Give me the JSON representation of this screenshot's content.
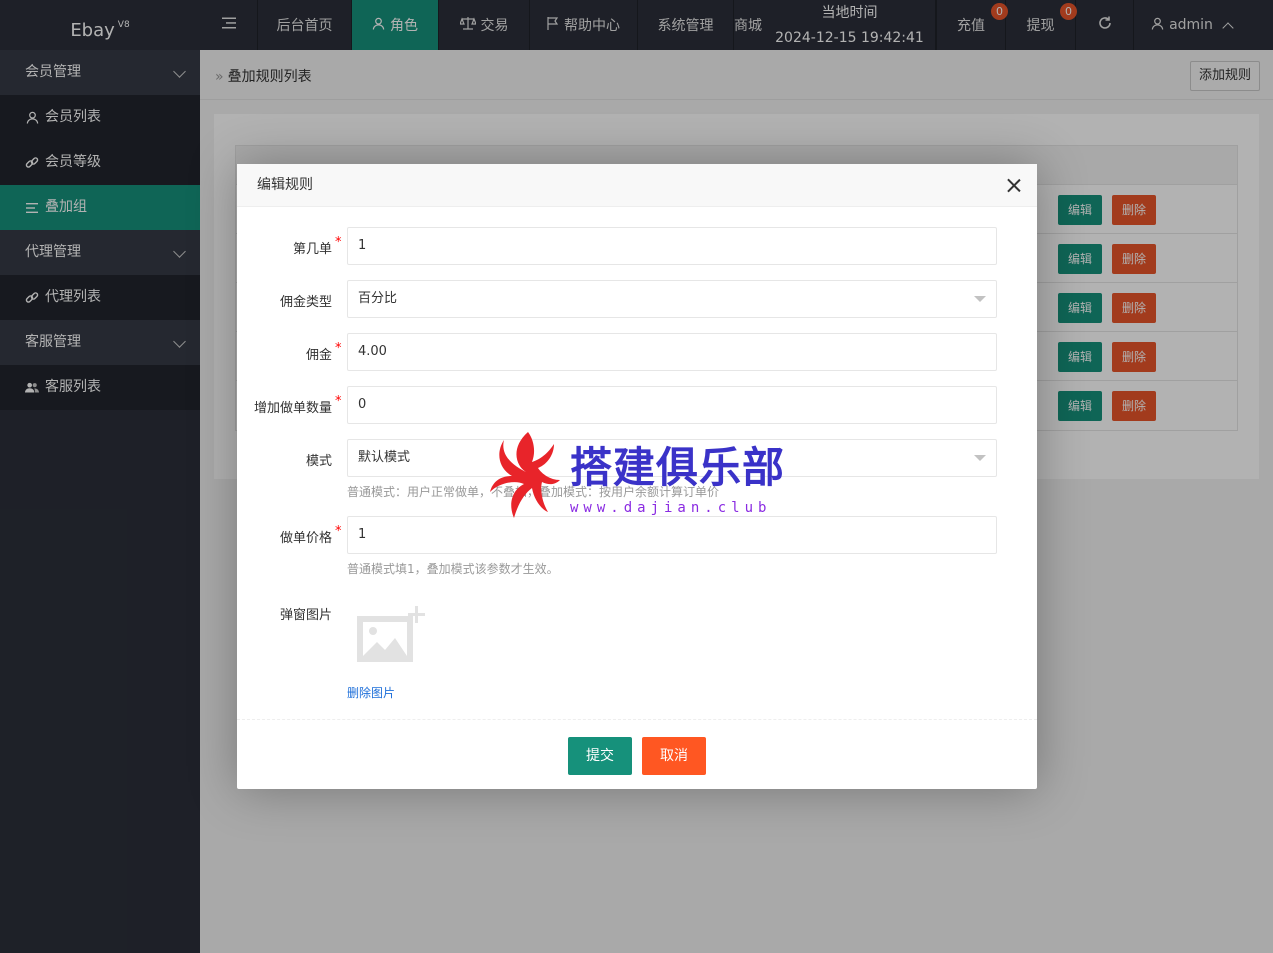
{
  "sidebar": {
    "logo": "Ebay",
    "logo_sup": "V8",
    "groups": [
      {
        "label": "会员管理",
        "items": [
          {
            "label": "会员列表",
            "icon": "user-icon"
          },
          {
            "label": "会员等级",
            "icon": "link-icon"
          },
          {
            "label": "叠加组",
            "icon": "list-icon",
            "active": true
          }
        ]
      },
      {
        "label": "代理管理",
        "items": [
          {
            "label": "代理列表",
            "icon": "link-icon"
          }
        ]
      },
      {
        "label": "客服管理",
        "items": [
          {
            "label": "客服列表",
            "icon": "users-icon"
          }
        ]
      }
    ]
  },
  "topbar": {
    "menu_icon": "menu-fold-icon",
    "items": [
      {
        "label": "后台首页"
      },
      {
        "label": "角色",
        "icon": "user-icon",
        "active": true
      },
      {
        "label": "交易",
        "icon": "scale-icon"
      },
      {
        "label": "帮助中心",
        "icon": "flag-icon"
      },
      {
        "label": "系统管理"
      },
      {
        "label": "商城"
      }
    ],
    "time_label": "当地时间",
    "time_value": "2024-12-15 19:42:41",
    "recharge": {
      "label": "充值",
      "badge": "0"
    },
    "withdraw": {
      "label": "提现",
      "badge": "0"
    },
    "refresh_icon": "refresh-icon",
    "user": {
      "name": "admin"
    }
  },
  "page": {
    "breadcrumb": "叠加规则列表",
    "add_button": "添加规则",
    "table": {
      "rows": [
        {
          "edit": "编辑",
          "delete": "删除"
        },
        {
          "edit": "编辑",
          "delete": "删除"
        },
        {
          "edit": "编辑",
          "delete": "删除"
        },
        {
          "edit": "编辑",
          "delete": "删除"
        },
        {
          "edit": "编辑",
          "delete": "删除"
        }
      ]
    }
  },
  "modal": {
    "title": "编辑规则",
    "fields": {
      "order_no": {
        "label": "第几单",
        "value": "1",
        "required": true
      },
      "commission_type": {
        "label": "佣金类型",
        "value": "百分比"
      },
      "commission": {
        "label": "佣金",
        "value": "4.00",
        "required": true
      },
      "extra_orders": {
        "label": "增加做单数量",
        "value": "0",
        "required": true
      },
      "mode": {
        "label": "模式",
        "value": "默认模式",
        "hint": "普通模式：用户正常做单，不叠加，叠加模式：按用户余额计算订单价"
      },
      "price": {
        "label": "做单价格",
        "value": "1",
        "required": true,
        "hint": "普通模式填1，叠加模式该参数才生效。"
      },
      "popup_image": {
        "label": "弹窗图片",
        "delete_link": "删除图片"
      }
    },
    "submit": "提交",
    "cancel": "取消"
  },
  "watermark": {
    "text": "搭建俱乐部",
    "url": "www.dajian.club"
  },
  "colors": {
    "accent": "#16917b",
    "danger": "#e8552a",
    "sidebar_bg": "#2b2f3a"
  }
}
